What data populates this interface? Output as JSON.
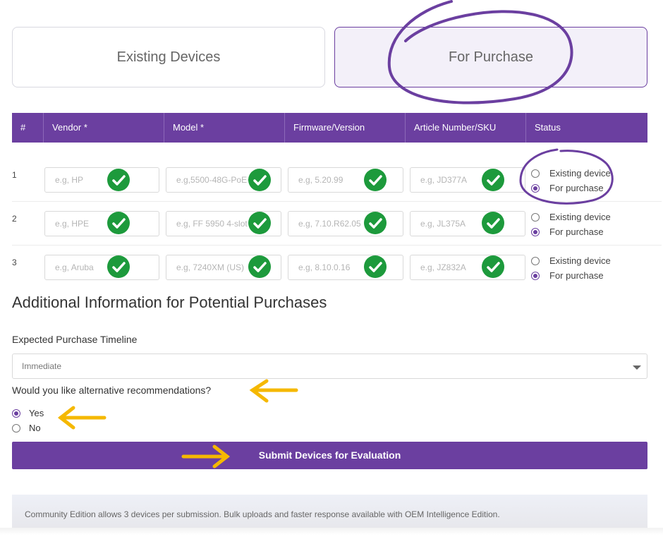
{
  "toggles": {
    "existing": "Existing Devices",
    "purchase": "For Purchase"
  },
  "table": {
    "headers": [
      "#",
      "Vendor *",
      "Model *",
      "Firmware/Version",
      "Article Number/SKU",
      "Status"
    ],
    "rows": [
      {
        "num": "1",
        "vendor": "e.g, HP",
        "model": "e.g,5500-48G-PoE+",
        "firmware": "e.g, 5.20.99",
        "sku": "e.g, JD377A"
      },
      {
        "num": "2",
        "vendor": "e.g, HPE",
        "model": "e.g, FF 5950 4-slot",
        "firmware": "e.g, 7.10.R62.05",
        "sku": "e.g, JL375A"
      },
      {
        "num": "3",
        "vendor": "e.g, Aruba",
        "model": "e.g, 7240XM (US)",
        "firmware": "e.g, 8.10.0.16",
        "sku": "e.g, JZ832A"
      }
    ],
    "status_options": [
      "Existing device",
      "For purchase"
    ],
    "status_selected": "For purchase"
  },
  "additional": {
    "title": "Additional Information for Potential Purchases",
    "timeline_label": "Expected Purchase Timeline",
    "timeline_value": "Immediate",
    "question": "Would you like alternative recommendations?",
    "options": [
      "Yes",
      "No"
    ],
    "selected": "Yes"
  },
  "submit_label": "Submit Devices for Evaluation",
  "footer_text": "Community Edition allows 3 devices per submission. Bulk uploads and faster response available with OEM Intelligence Edition.",
  "colors": {
    "accent": "#6b3fa0",
    "check": "#1d9a3c",
    "arrow": "#f5b800"
  }
}
